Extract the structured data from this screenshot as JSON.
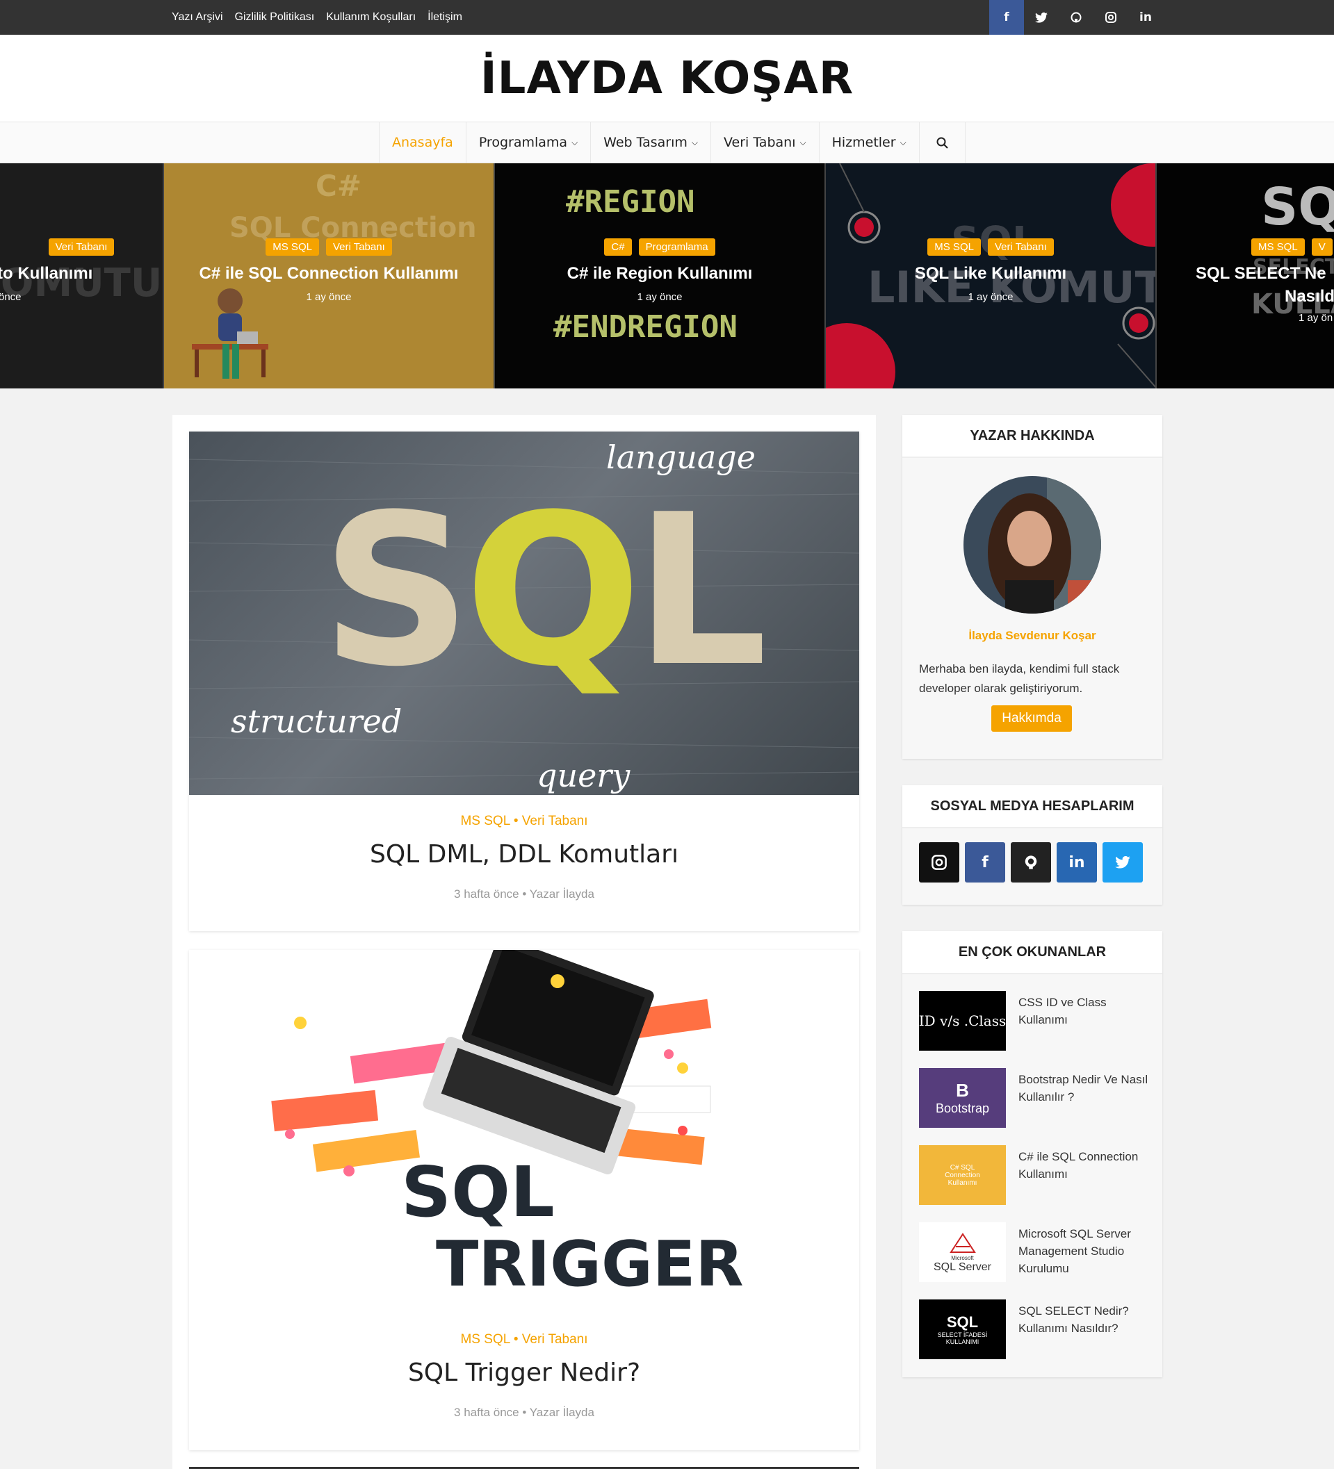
{
  "topbar": {
    "links": [
      "Yazı Arşivi",
      "Gizlilik Politikası",
      "Kullanım Koşulları",
      "İletişim"
    ],
    "social_icons": [
      "facebook-icon",
      "twitter-icon",
      "github-icon",
      "instagram-icon",
      "linkedin-icon"
    ]
  },
  "header": {
    "logo_text_1": "İLAYDA KO",
    "logo_text_2": "Ş",
    "logo_text_3": "AR"
  },
  "nav": {
    "items": [
      "Anasayfa",
      "Programlama",
      "Web Tasarım",
      "Veri Tabanı",
      "Hizmetler"
    ],
    "active": "Anasayfa"
  },
  "slider": [
    {
      "cats": [
        "Veri Tabanı"
      ],
      "title": "to Kullanımı",
      "date": "önce"
    },
    {
      "cats": [
        "MS SQL",
        "Veri Tabanı"
      ],
      "title": "C# ile SQL Connection Kullanımı",
      "date": "1 ay önce"
    },
    {
      "cats": [
        "C#",
        "Programlama"
      ],
      "title": "C# ile Region Kullanımı",
      "date": "1 ay önce"
    },
    {
      "cats": [
        "MS SQL",
        "Veri Tabanı"
      ],
      "title": "SQL Like Kullanımı",
      "date": "1 ay önce"
    },
    {
      "cats": [
        "MS SQL",
        "V"
      ],
      "title": "SQL SELECT Ne",
      "title2": "Nasıld",
      "date": "1 ay ön"
    }
  ],
  "slider_bg": {
    "s0": "KOMUTU",
    "s1a": "C#",
    "s1b": "SQL Connection",
    "s2a": "#REGION",
    "s2b": "#ENDREGION",
    "s3a": "SQL",
    "s3b": "LIKE KOMUTU",
    "s4a": "SQ",
    "s4b": "SELECT",
    "s4c": "KULLA"
  },
  "posts": [
    {
      "cats": "MS SQL • Veri Tabanı",
      "title": "SQL DML, DDL Komutları",
      "meta": "3 hafta önce • Yazar İlayda",
      "img_text": {
        "main": "SQL",
        "a": "language",
        "b": "structured",
        "c": "query"
      }
    },
    {
      "cats": "MS SQL • Veri Tabanı",
      "title": "SQL Trigger Nedir?",
      "meta": "3 hafta önce • Yazar İlayda",
      "img_text": {
        "a": "SQL",
        "b": "TRIGGER"
      }
    }
  ],
  "sidebar": {
    "about": {
      "title": "YAZAR HAKKINDA",
      "name": "İlayda Sevdenur Koşar",
      "bio": "Merhaba ben ilayda, kendimi full stack developer olarak  geliştiriyorum.",
      "button": "Hakkımda"
    },
    "social": {
      "title": "SOSYAL MEDYA HESAPLARIM",
      "icons": [
        "instagram-icon",
        "facebook-icon",
        "github-icon",
        "linkedin-icon",
        "twitter-icon"
      ],
      "colors": [
        "#111111",
        "#3b5998",
        "#222222",
        "#2867b2",
        "#1da1f2"
      ]
    },
    "popular": {
      "title": "EN ÇOK OKUNANLAR",
      "items": [
        {
          "title": "CSS ID ve Class Kullanımı",
          "thumb": "ID v/s .Class"
        },
        {
          "title": "Bootstrap Nedir Ve Nasıl Kullanılır ?",
          "thumb": "B",
          "thumb2": "Bootstrap"
        },
        {
          "title": "C# ile SQL Connection Kullanımı",
          "thumb": "C# SQL Connection Kullanımı"
        },
        {
          "title": "Microsoft SQL Server Management Studio Kurulumu",
          "thumb": "SQL Server",
          "thumb2": "Microsoft"
        },
        {
          "title": "SQL SELECT Nedir? Kullanımı Nasıldır?",
          "thumb": "SQL",
          "thumb2": "SELECT İFADESİ KULLANIMI"
        }
      ]
    }
  }
}
